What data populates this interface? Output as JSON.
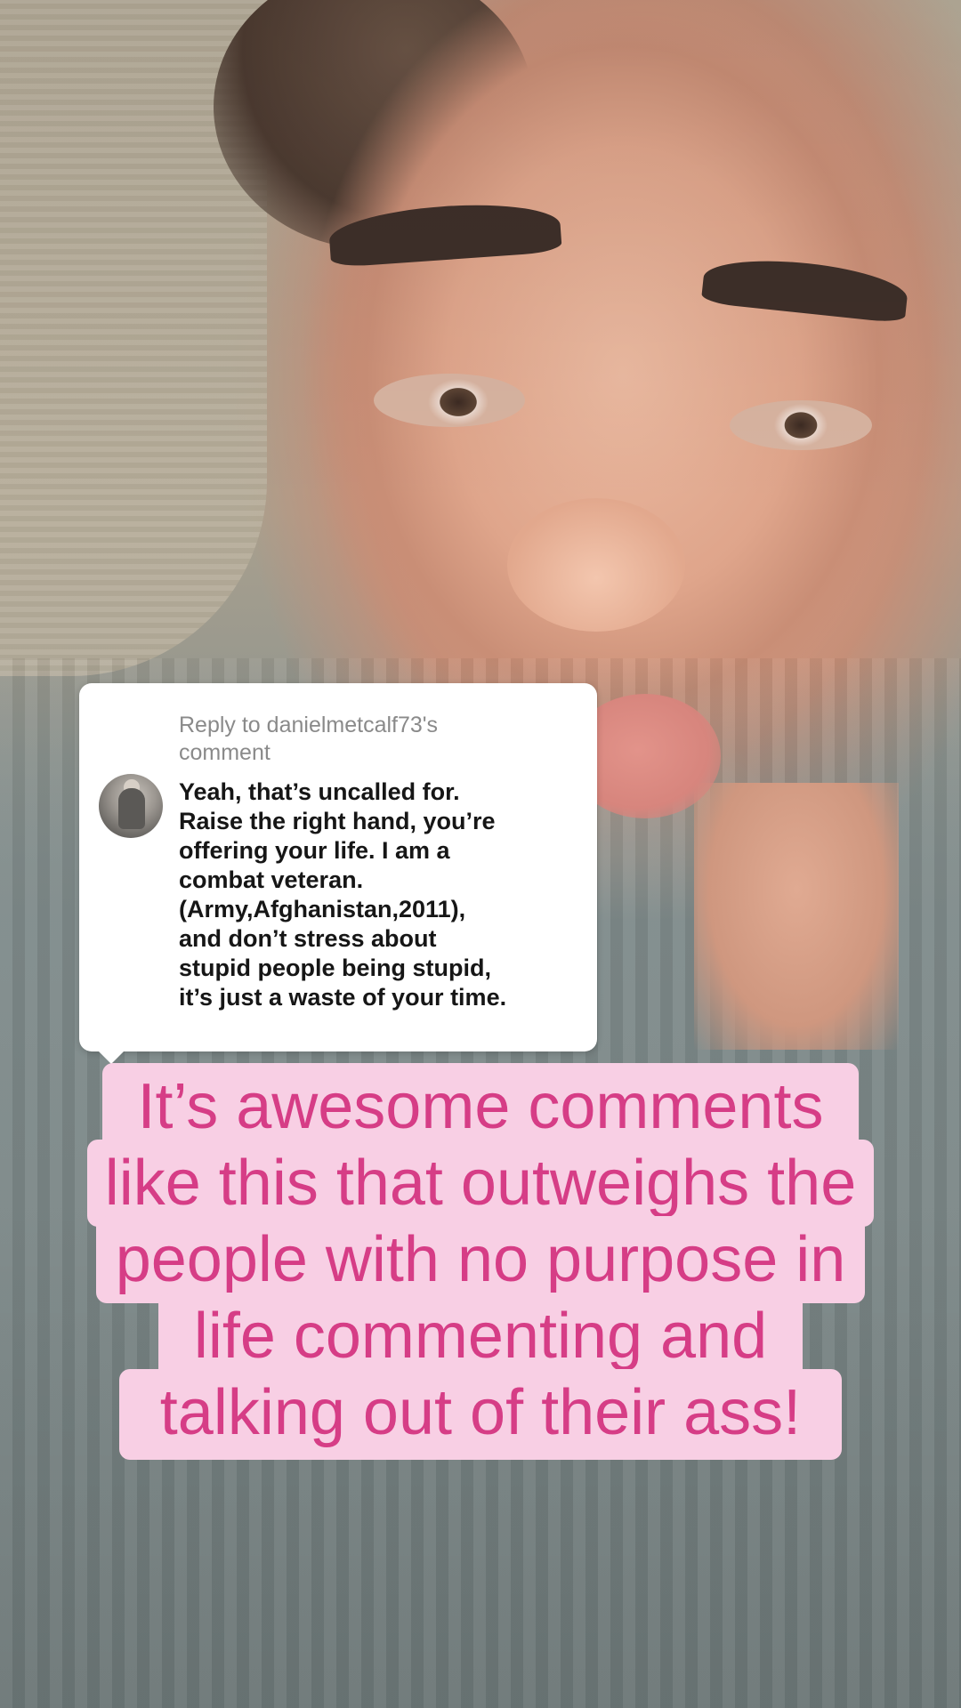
{
  "reply": {
    "prefix": "Reply to",
    "username": "danielmetcalf73's",
    "suffix": "comment",
    "avatar_icon": "user-avatar-photo",
    "comment_lines": [
      "Yeah, that’s uncalled for.",
      "Raise the right hand, you’re",
      "offering your life. I am a",
      "combat veteran.",
      "(Army,Afghanistan,2011),",
      "and don’t stress about",
      "stupid people being stupid,",
      "it’s just a waste of your time."
    ]
  },
  "caption": {
    "lines": [
      "It’s awesome comments",
      "like this that outweighs the",
      "people with no purpose in",
      "life commenting and",
      "talking out of their ass!"
    ],
    "text_color": "#d63d86",
    "background_color": "#f8cfe4"
  }
}
